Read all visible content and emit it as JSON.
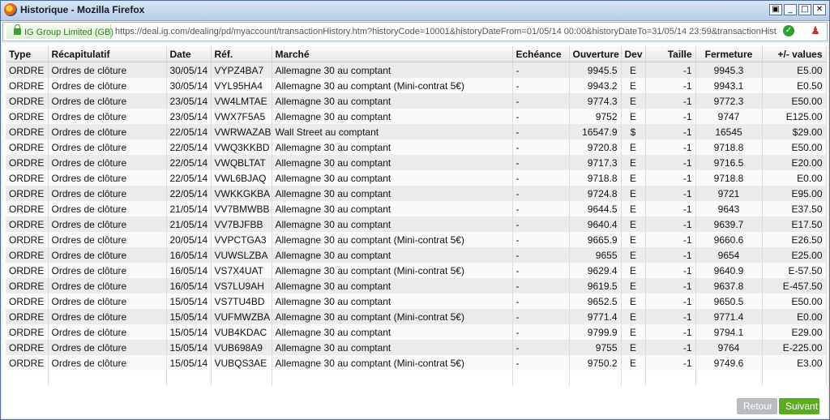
{
  "window": {
    "title": "Historique - Mozilla Firefox",
    "controls": [
      "▣",
      "_",
      "□",
      "✕"
    ]
  },
  "addressbar": {
    "identity": "IG Group Limited (GB)",
    "url": "https://deal.ig.com/dealing/pd/myaccount/transactionHistory.htm?historyCode=10001&historyDateFrom=01/05/14 00:00&historyDateTo=31/05/14 23:59&transactionHistoryF"
  },
  "icons": {
    "lock": "lock-icon",
    "check": "check-icon",
    "tool": "toolbar-tool-icon"
  },
  "colors": {
    "accent_green": "#5aab1f",
    "disabled_gray": "#b8bcc0"
  },
  "table": {
    "headers": [
      "Type",
      "Récapitulatif",
      "Date",
      "Réf.",
      "Marché",
      "Echéance",
      "Ouverture",
      "Dev",
      "Taille",
      "Fermeture",
      "+/- values"
    ],
    "rows": [
      [
        "ORDRE",
        "Ordres de clôture",
        "30/05/14",
        "VYPZ4BA7",
        "Allemagne 30 au comptant",
        "-",
        "9945.5",
        "E",
        "-1",
        "9945.3",
        "E5.00"
      ],
      [
        "ORDRE",
        "Ordres de clôture",
        "30/05/14",
        "VYL95HA4",
        "Allemagne 30 au comptant (Mini-contrat 5€)",
        "-",
        "9943.2",
        "E",
        "-1",
        "9943.1",
        "E0.50"
      ],
      [
        "ORDRE",
        "Ordres de clôture",
        "23/05/14",
        "VW4LMTAE",
        "Allemagne 30 au comptant",
        "-",
        "9774.3",
        "E",
        "-1",
        "9772.3",
        "E50.00"
      ],
      [
        "ORDRE",
        "Ordres de clôture",
        "23/05/14",
        "VWX7F5A5",
        "Allemagne 30 au comptant",
        "-",
        "9752",
        "E",
        "-1",
        "9747",
        "E125.00"
      ],
      [
        "ORDRE",
        "Ordres de clôture",
        "22/05/14",
        "VWRWAZAB",
        "Wall Street au comptant",
        "-",
        "16547.9",
        "$",
        "-1",
        "16545",
        "$29.00"
      ],
      [
        "ORDRE",
        "Ordres de clôture",
        "22/05/14",
        "VWQ3KKBD",
        "Allemagne 30 au comptant",
        "-",
        "9720.8",
        "E",
        "-1",
        "9718.8",
        "E50.00"
      ],
      [
        "ORDRE",
        "Ordres de clôture",
        "22/05/14",
        "VWQBLTAT",
        "Allemagne 30 au comptant",
        "-",
        "9717.3",
        "E",
        "-1",
        "9716.5",
        "E20.00"
      ],
      [
        "ORDRE",
        "Ordres de clôture",
        "22/05/14",
        "VWL6BJAQ",
        "Allemagne 30 au comptant",
        "-",
        "9718.8",
        "E",
        "-1",
        "9718.8",
        "E0.00"
      ],
      [
        "ORDRE",
        "Ordres de clôture",
        "22/05/14",
        "VWKKGKBA",
        "Allemagne 30 au comptant",
        "-",
        "9724.8",
        "E",
        "-1",
        "9721",
        "E95.00"
      ],
      [
        "ORDRE",
        "Ordres de clôture",
        "21/05/14",
        "VV7BMWBB",
        "Allemagne 30 au comptant",
        "-",
        "9644.5",
        "E",
        "-1",
        "9643",
        "E37.50"
      ],
      [
        "ORDRE",
        "Ordres de clôture",
        "21/05/14",
        "VV7BJFBB",
        "Allemagne 30 au comptant",
        "-",
        "9640.4",
        "E",
        "-1",
        "9639.7",
        "E17.50"
      ],
      [
        "ORDRE",
        "Ordres de clôture",
        "20/05/14",
        "VVPCTGA3",
        "Allemagne 30 au comptant (Mini-contrat 5€)",
        "-",
        "9665.9",
        "E",
        "-1",
        "9660.6",
        "E26.50"
      ],
      [
        "ORDRE",
        "Ordres de clôture",
        "16/05/14",
        "VUWSLZBA",
        "Allemagne 30 au comptant",
        "-",
        "9655",
        "E",
        "-1",
        "9654",
        "E25.00"
      ],
      [
        "ORDRE",
        "Ordres de clôture",
        "16/05/14",
        "VS7X4UAT",
        "Allemagne 30 au comptant (Mini-contrat 5€)",
        "-",
        "9629.4",
        "E",
        "-1",
        "9640.9",
        "E-57.50"
      ],
      [
        "ORDRE",
        "Ordres de clôture",
        "16/05/14",
        "VS7LU9AH",
        "Allemagne 30 au comptant",
        "-",
        "9619.5",
        "E",
        "-1",
        "9637.8",
        "E-457.50"
      ],
      [
        "ORDRE",
        "Ordres de clôture",
        "15/05/14",
        "VS7TU4BD",
        "Allemagne 30 au comptant",
        "-",
        "9652.5",
        "E",
        "-1",
        "9650.5",
        "E50.00"
      ],
      [
        "ORDRE",
        "Ordres de clôture",
        "15/05/14",
        "VUFMWZBA",
        "Allemagne 30 au comptant (Mini-contrat 5€)",
        "-",
        "9771.4",
        "E",
        "-1",
        "9771.4",
        "E0.00"
      ],
      [
        "ORDRE",
        "Ordres de clôture",
        "15/05/14",
        "VUB4KDAC",
        "Allemagne 30 au comptant",
        "-",
        "9799.9",
        "E",
        "-1",
        "9794.1",
        "E29.00"
      ],
      [
        "ORDRE",
        "Ordres de clôture",
        "15/05/14",
        "VUB698A9",
        "Allemagne 30 au comptant",
        "-",
        "9755",
        "E",
        "-1",
        "9764",
        "E-225.00"
      ],
      [
        "ORDRE",
        "Ordres de clôture",
        "15/05/14",
        "VUBQS3AE",
        "Allemagne 30 au comptant (Mini-contrat 5€)",
        "-",
        "9750.2",
        "E",
        "-1",
        "9749.6",
        "E3.00"
      ]
    ]
  },
  "pagination": {
    "back_label": "Retour",
    "next_label": "Suivant"
  }
}
